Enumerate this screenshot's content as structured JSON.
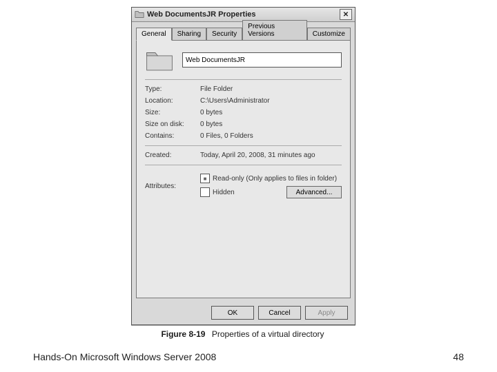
{
  "dialog": {
    "title": "Web DocumentsJR Properties",
    "close_label": "✕",
    "tabs": [
      "General",
      "Sharing",
      "Security",
      "Previous Versions",
      "Customize"
    ],
    "active_tab": 0,
    "name_value": "Web DocumentsJR",
    "fields": {
      "type_label": "Type:",
      "type_value": "File Folder",
      "location_label": "Location:",
      "location_value": "C:\\Users\\Administrator",
      "size_label": "Size:",
      "size_value": "0 bytes",
      "size_on_disk_label": "Size on disk:",
      "size_on_disk_value": "0 bytes",
      "contains_label": "Contains:",
      "contains_value": "0 Files, 0 Folders",
      "created_label": "Created:",
      "created_value": "Today, April 20, 2008, 31 minutes ago",
      "attributes_label": "Attributes:",
      "readonly_label": "Read-only (Only applies to files in folder)",
      "hidden_label": "Hidden",
      "advanced_label": "Advanced..."
    },
    "buttons": {
      "ok": "OK",
      "cancel": "Cancel",
      "apply": "Apply"
    }
  },
  "caption": {
    "fignum": "Figure 8-19",
    "text": "Properties of a virtual directory"
  },
  "footer": {
    "left": "Hands-On Microsoft Windows Server 2008",
    "right": "48"
  }
}
